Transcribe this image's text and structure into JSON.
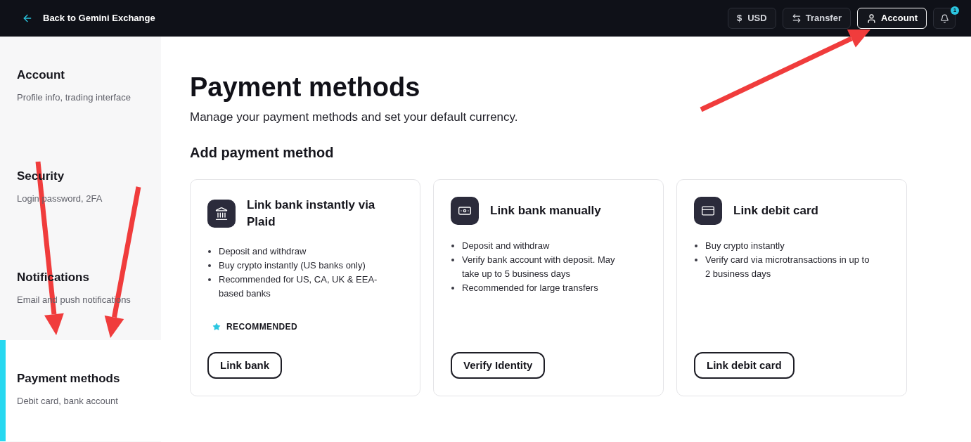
{
  "top_bar": {
    "back_link": "Back to Gemini Exchange",
    "buttons": [
      {
        "kind": "currency",
        "symbol": "$",
        "label": "USD",
        "selected": false
      },
      {
        "kind": "transfer",
        "label": "Transfer",
        "selected": false
      },
      {
        "kind": "account",
        "label": "Account",
        "selected": true
      }
    ],
    "notifications": {
      "badge": "1"
    }
  },
  "sidebar": {
    "items": [
      {
        "title": "Account",
        "subtitle": "Profile info, trading interface",
        "selected": false
      },
      {
        "title": "Security",
        "subtitle": "Login password, 2FA",
        "selected": false
      },
      {
        "title": "Notifications",
        "subtitle": "Email and push notifications",
        "selected": false
      },
      {
        "title": "Payment methods",
        "subtitle": "Debit card, bank account",
        "selected": true
      }
    ]
  },
  "main": {
    "title": "Payment methods",
    "subtitle": "Manage your payment methods and set your default currency.",
    "section_title": "Add payment method",
    "cards": [
      {
        "kind": "bank",
        "title": "Link bank instantly via Plaid",
        "bullets": [
          "Deposit and withdraw",
          "Buy crypto instantly (US banks only)",
          "Recommended for US, CA, UK & EEA-based banks"
        ],
        "badge": "RECOMMENDED",
        "button": "Link bank"
      },
      {
        "kind": "manual",
        "title": "Link bank manually",
        "bullets": [
          "Deposit and withdraw",
          "Verify bank account with deposit. May take up to 5 business days",
          "Recommended for large transfers"
        ],
        "button": "Verify Identity"
      },
      {
        "kind": "card",
        "title": "Link debit card",
        "bullets": [
          "Buy crypto instantly",
          "Verify card via microtransactions in up to 2 business days"
        ],
        "button": "Link debit card"
      }
    ]
  }
}
